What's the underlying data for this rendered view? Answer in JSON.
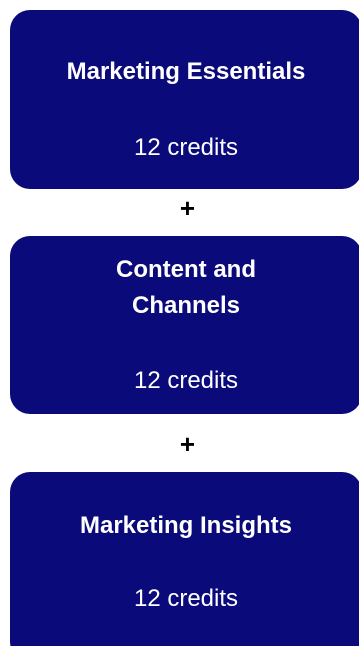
{
  "cards": [
    {
      "title": "Marketing Essentials",
      "credits": "12 credits"
    },
    {
      "title": "Content and\nChannels",
      "credits": "12 credits"
    },
    {
      "title": "Marketing Insights",
      "credits": "12 credits"
    }
  ],
  "separator": "+",
  "colors": {
    "card_background": "#0a0a7a",
    "card_text": "#ffffff",
    "separator": "#000000"
  }
}
